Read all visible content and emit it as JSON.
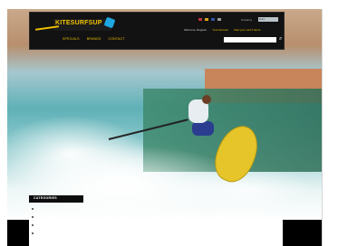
{
  "brand": {
    "logo_text": "KITESURFSUP",
    "accent": "#f2c400",
    "accent_blue": "#1ea7e1"
  },
  "nav": {
    "items": [
      "SPECIALS",
      "BRANDS",
      "CONTACT"
    ]
  },
  "header": {
    "currency_label": "Currency",
    "currency_value": "Euro",
    "links": {
      "welcome": "Welcome, Register",
      "account": "Your Account",
      "cart": "View your cart  0 items"
    },
    "search_placeholder": ""
  },
  "sidebar": {
    "categories_title": "CATEGORIES",
    "category_count": 4
  },
  "footer": {
    "text": ""
  },
  "icons": {
    "search": "search-icon",
    "flags": [
      "flag-uk",
      "flag-de",
      "flag-fr",
      "flag-nl"
    ]
  }
}
